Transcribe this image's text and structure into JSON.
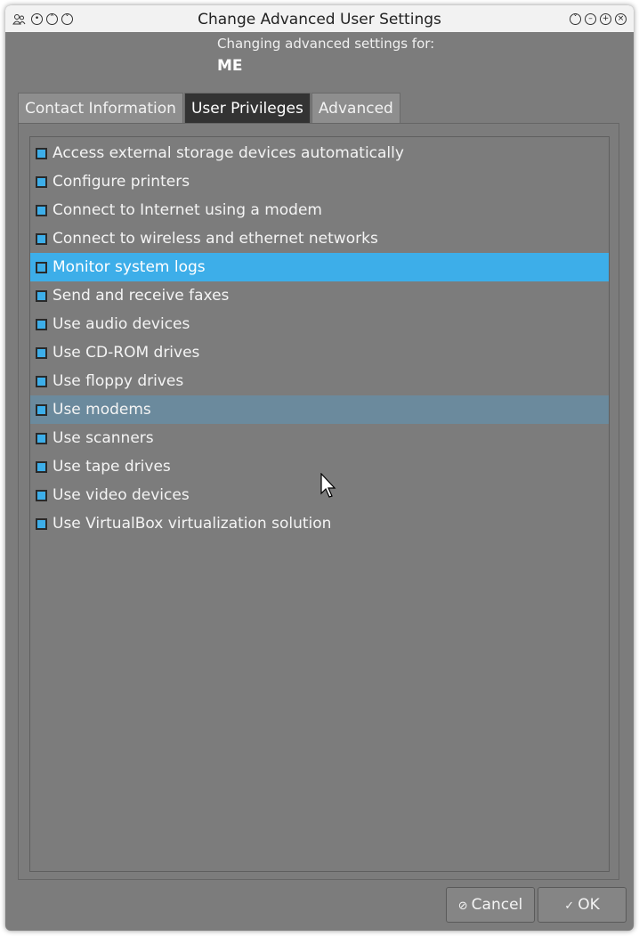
{
  "window": {
    "title": "Change Advanced User Settings"
  },
  "header": {
    "label": "Changing advanced settings for:",
    "user": "ME"
  },
  "tabs": [
    {
      "label": "Contact Information",
      "active": false
    },
    {
      "label": "User Privileges",
      "active": true
    },
    {
      "label": "Advanced",
      "active": false
    }
  ],
  "privileges": [
    {
      "label": "Access external storage devices automatically",
      "checked": true
    },
    {
      "label": "Configure printers",
      "checked": true
    },
    {
      "label": "Connect to Internet using a modem",
      "checked": true
    },
    {
      "label": "Connect to wireless and ethernet networks",
      "checked": true
    },
    {
      "label": "Monitor system logs",
      "checked": true
    },
    {
      "label": "Send and receive faxes",
      "checked": true
    },
    {
      "label": "Use audio devices",
      "checked": true
    },
    {
      "label": "Use CD-ROM drives",
      "checked": true
    },
    {
      "label": "Use floppy drives",
      "checked": true
    },
    {
      "label": "Use modems",
      "checked": true
    },
    {
      "label": "Use scanners",
      "checked": true
    },
    {
      "label": "Use tape drives",
      "checked": true
    },
    {
      "label": "Use video devices",
      "checked": true
    },
    {
      "label": "Use VirtualBox virtualization solution",
      "checked": true
    }
  ],
  "buttons": {
    "cancel": "Cancel",
    "ok": "OK"
  },
  "colors": {
    "selection": "#3daee9",
    "hover": "#6b8a9d",
    "window_bg": "#7c7c7c",
    "active_tab": "#333333"
  },
  "icons": {
    "app": "users-icon",
    "title_left": [
      "pin-icon",
      "chevron-up-icon",
      "chevron-down-icon"
    ],
    "title_right": [
      "shade-icon",
      "minimize-icon",
      "maximize-icon",
      "close-icon"
    ],
    "cancel": "cancel-icon",
    "ok": "checkmark-icon"
  }
}
